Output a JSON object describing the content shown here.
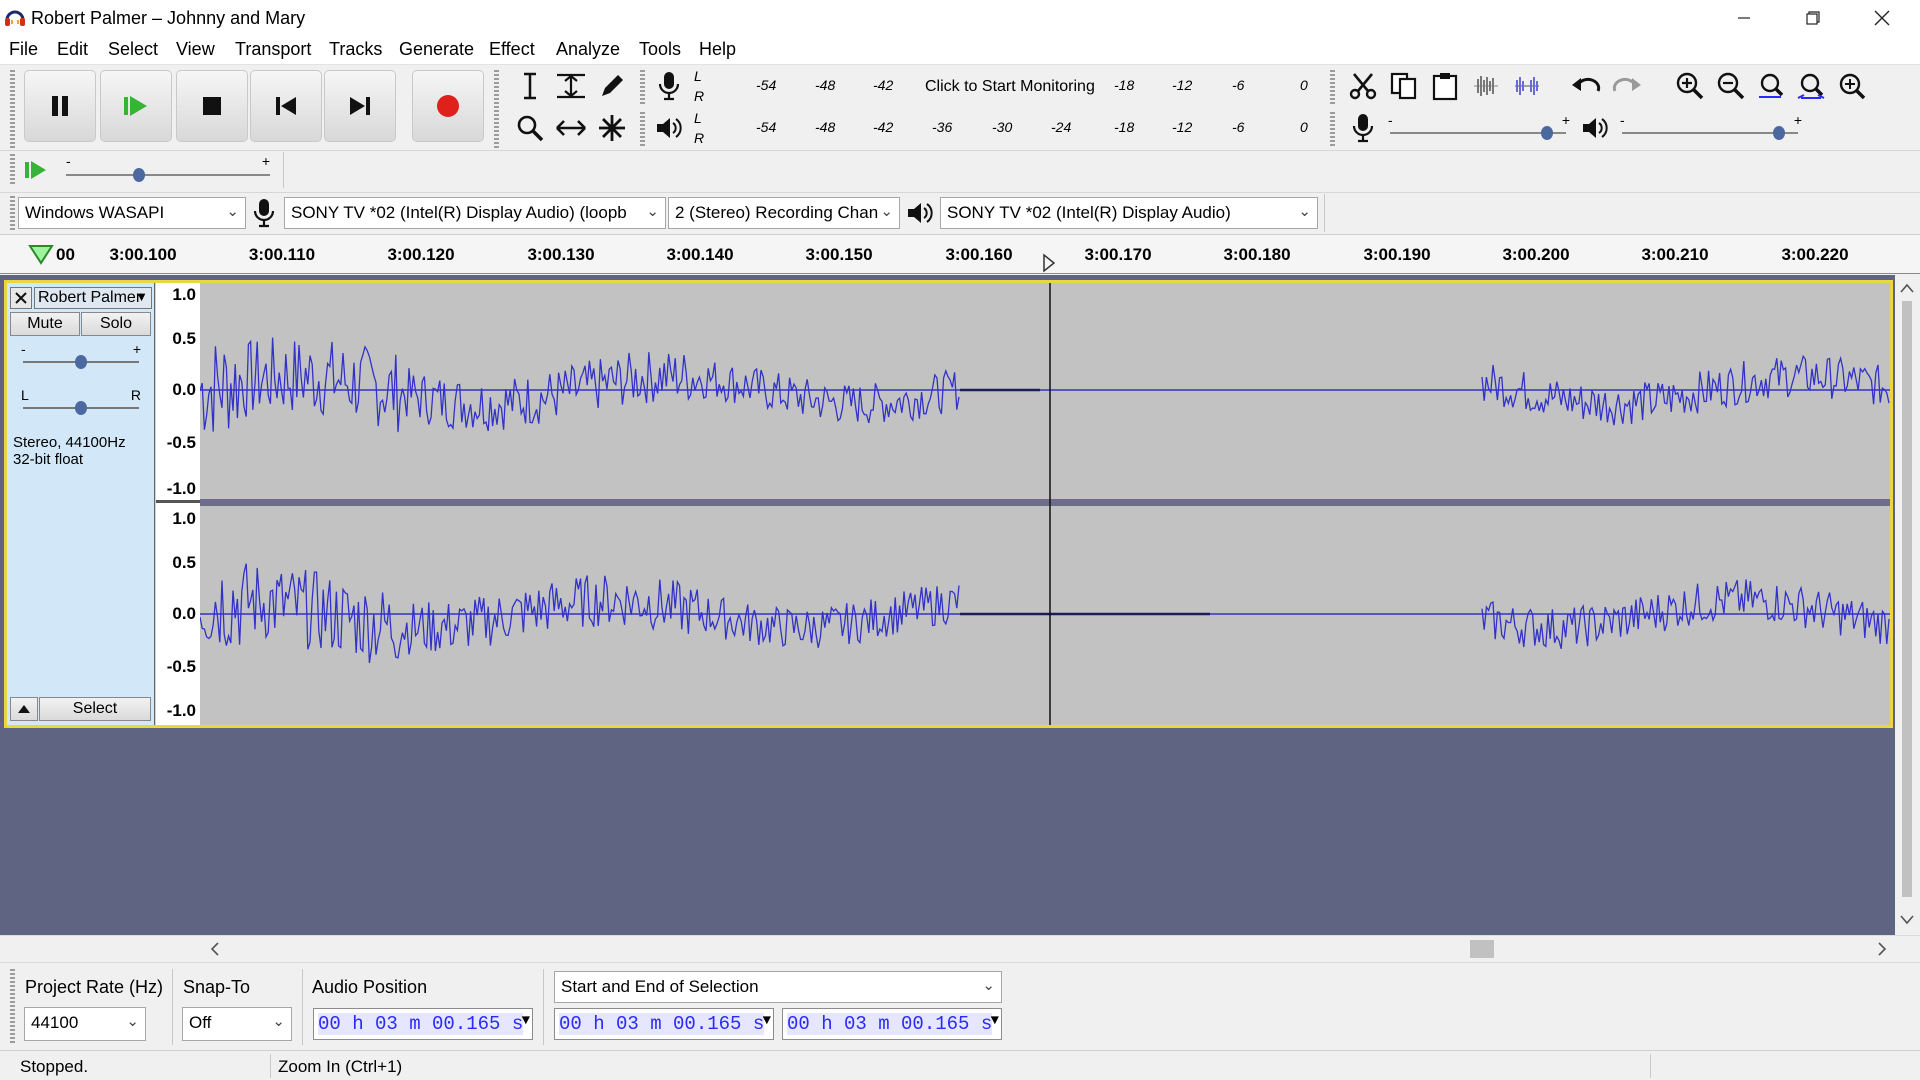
{
  "window": {
    "title": "Robert Palmer – Johnny and Mary",
    "minimize_icon": "minimize-icon",
    "restore_icon": "restore-icon",
    "close_icon": "close-icon"
  },
  "menu": [
    "File",
    "Edit",
    "Select",
    "View",
    "Transport",
    "Tracks",
    "Generate",
    "Effect",
    "Analyze",
    "Tools",
    "Help"
  ],
  "transport": {
    "buttons": [
      "pause",
      "play",
      "stop",
      "skip-to-start",
      "skip-to-end",
      "record"
    ]
  },
  "meters": {
    "record_scale": [
      "-54",
      "-48",
      "-42",
      "-18",
      "-12",
      "-6",
      "0"
    ],
    "record_prompt": "Click to Start Monitoring",
    "play_scale": [
      "-54",
      "-48",
      "-42",
      "-36",
      "-30",
      "-24",
      "-18",
      "-12",
      "-6",
      "0"
    ],
    "channel_l": "L",
    "channel_r": "R"
  },
  "mixer": {
    "minus": "-",
    "plus": "+",
    "record_volume": 0.9,
    "playback_volume": 0.9
  },
  "play_at_speed": {
    "minus": "-",
    "plus": "+",
    "speed": 0.35
  },
  "devices": {
    "host": "Windows WASAPI",
    "recording_device": "SONY TV  *02 (Intel(R) Display Audio) (loopb",
    "channels": "2 (Stereo) Recording Chan",
    "playback_device": "SONY TV  *02 (Intel(R) Display Audio)"
  },
  "timeline": {
    "start_partial": "00",
    "ticks": [
      "3:00.100",
      "3:00.110",
      "3:00.120",
      "3:00.130",
      "3:00.140",
      "3:00.150",
      "3:00.160",
      "3:00.170",
      "3:00.180",
      "3:00.190",
      "3:00.200",
      "3:00.210",
      "3:00.220"
    ]
  },
  "track": {
    "name": "Robert Palmer",
    "mute_label": "Mute",
    "solo_label": "Solo",
    "gain_minus": "-",
    "gain_plus": "+",
    "pan_left": "L",
    "pan_right": "R",
    "gain_level": 0.5,
    "pan_level": 0.5,
    "info_line1": "Stereo, 44100Hz",
    "info_line2": "32-bit float",
    "select_label": "Select",
    "vruler_labels": [
      "1.0",
      "0.5",
      "0.0",
      "-0.5",
      "-1.0"
    ],
    "wave_color": "#3232c8",
    "selection_color": "#e7d83f"
  },
  "selection_toolbar": {
    "project_rate_label": "Project Rate (Hz)",
    "project_rate_value": "44100",
    "snap_to_label": "Snap-To",
    "snap_to_value": "Off",
    "audio_position_label": "Audio Position",
    "audio_position_value": "00 h 03 m 00.165 s",
    "selection_mode": "Start and End of Selection",
    "selection_start": "00 h 03 m 00.165 s",
    "selection_end": "00 h 03 m 00.165 s"
  },
  "status": {
    "state": "Stopped.",
    "hint": "Zoom In (Ctrl+1)"
  }
}
